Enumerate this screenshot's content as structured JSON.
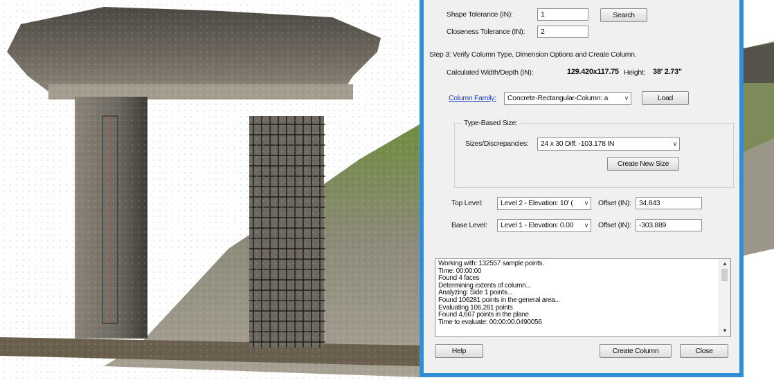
{
  "colors": {
    "dialog_border": "#2f8fd6",
    "dialog_bg": "#f0f0f0",
    "link": "#1f3fbf"
  },
  "step2": {
    "shape_tolerance_label": "Shape Tolerance (IN):",
    "shape_tolerance_value": "1",
    "search_label": "Search",
    "closeness_tolerance_label": "Closeness Tolerance (IN):",
    "closeness_tolerance_value": "2"
  },
  "step3": {
    "heading": "Step 3: Verify Column Type, Dimension Options and Create Column.",
    "calc_label": "Calculated Width/Depth (IN):",
    "calc_value": "129.420x117.75",
    "height_label": "Height:",
    "height_value": "38' 2.73\"",
    "column_family_label": "Column Family:",
    "column_family_value": "Concrete-Rectangular-Column: a",
    "load_label": "Load",
    "type_based_size_label": "Type-Based Size:",
    "sizes_label": "Sizes/Discrepancies:",
    "sizes_value": "24 x 30 Diff: -103.178 IN",
    "create_new_size_label": "Create New Size",
    "top_level_label": "Top Level:",
    "top_level_value": "Level 2 - Elevation: 10' (",
    "top_offset_label": "Offset (IN):",
    "top_offset_value": "34.843",
    "base_level_label": "Base Level:",
    "base_level_value": "Level 1 - Elevation: 0.00",
    "base_offset_label": "Offset (IN):",
    "base_offset_value": "-303.889"
  },
  "log": {
    "lines": [
      "Working with: 132557 sample points.",
      "Time: 00:00:00",
      "Found 4 faces",
      "Determining extents of column...",
      "Analyzing: Side 1 points...",
      "Found 106281 points in the general area...",
      "Evaluating 106,281 points",
      "Found 4,667 points in the plane",
      "Time to evaluate: 00:00:00.0490056"
    ]
  },
  "footer": {
    "help_label": "Help",
    "create_column_label": "Create Column",
    "close_label": "Close"
  }
}
